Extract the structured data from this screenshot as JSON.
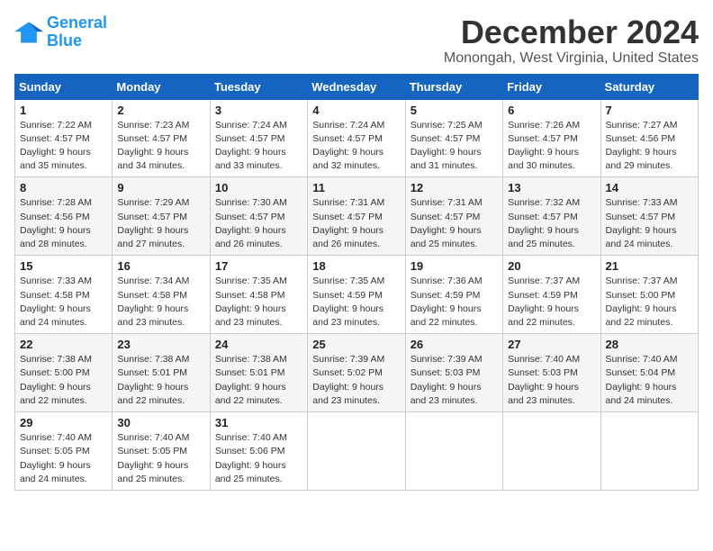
{
  "logo": {
    "line1": "General",
    "line2": "Blue"
  },
  "title": "December 2024",
  "subtitle": "Monongah, West Virginia, United States",
  "weekdays": [
    "Sunday",
    "Monday",
    "Tuesday",
    "Wednesday",
    "Thursday",
    "Friday",
    "Saturday"
  ],
  "weeks": [
    [
      {
        "day": "1",
        "info": "Sunrise: 7:22 AM\nSunset: 4:57 PM\nDaylight: 9 hours\nand 35 minutes."
      },
      {
        "day": "2",
        "info": "Sunrise: 7:23 AM\nSunset: 4:57 PM\nDaylight: 9 hours\nand 34 minutes."
      },
      {
        "day": "3",
        "info": "Sunrise: 7:24 AM\nSunset: 4:57 PM\nDaylight: 9 hours\nand 33 minutes."
      },
      {
        "day": "4",
        "info": "Sunrise: 7:24 AM\nSunset: 4:57 PM\nDaylight: 9 hours\nand 32 minutes."
      },
      {
        "day": "5",
        "info": "Sunrise: 7:25 AM\nSunset: 4:57 PM\nDaylight: 9 hours\nand 31 minutes."
      },
      {
        "day": "6",
        "info": "Sunrise: 7:26 AM\nSunset: 4:57 PM\nDaylight: 9 hours\nand 30 minutes."
      },
      {
        "day": "7",
        "info": "Sunrise: 7:27 AM\nSunset: 4:56 PM\nDaylight: 9 hours\nand 29 minutes."
      }
    ],
    [
      {
        "day": "8",
        "info": "Sunrise: 7:28 AM\nSunset: 4:56 PM\nDaylight: 9 hours\nand 28 minutes."
      },
      {
        "day": "9",
        "info": "Sunrise: 7:29 AM\nSunset: 4:57 PM\nDaylight: 9 hours\nand 27 minutes."
      },
      {
        "day": "10",
        "info": "Sunrise: 7:30 AM\nSunset: 4:57 PM\nDaylight: 9 hours\nand 26 minutes."
      },
      {
        "day": "11",
        "info": "Sunrise: 7:31 AM\nSunset: 4:57 PM\nDaylight: 9 hours\nand 26 minutes."
      },
      {
        "day": "12",
        "info": "Sunrise: 7:31 AM\nSunset: 4:57 PM\nDaylight: 9 hours\nand 25 minutes."
      },
      {
        "day": "13",
        "info": "Sunrise: 7:32 AM\nSunset: 4:57 PM\nDaylight: 9 hours\nand 25 minutes."
      },
      {
        "day": "14",
        "info": "Sunrise: 7:33 AM\nSunset: 4:57 PM\nDaylight: 9 hours\nand 24 minutes."
      }
    ],
    [
      {
        "day": "15",
        "info": "Sunrise: 7:33 AM\nSunset: 4:58 PM\nDaylight: 9 hours\nand 24 minutes."
      },
      {
        "day": "16",
        "info": "Sunrise: 7:34 AM\nSunset: 4:58 PM\nDaylight: 9 hours\nand 23 minutes."
      },
      {
        "day": "17",
        "info": "Sunrise: 7:35 AM\nSunset: 4:58 PM\nDaylight: 9 hours\nand 23 minutes."
      },
      {
        "day": "18",
        "info": "Sunrise: 7:35 AM\nSunset: 4:59 PM\nDaylight: 9 hours\nand 23 minutes."
      },
      {
        "day": "19",
        "info": "Sunrise: 7:36 AM\nSunset: 4:59 PM\nDaylight: 9 hours\nand 22 minutes."
      },
      {
        "day": "20",
        "info": "Sunrise: 7:37 AM\nSunset: 4:59 PM\nDaylight: 9 hours\nand 22 minutes."
      },
      {
        "day": "21",
        "info": "Sunrise: 7:37 AM\nSunset: 5:00 PM\nDaylight: 9 hours\nand 22 minutes."
      }
    ],
    [
      {
        "day": "22",
        "info": "Sunrise: 7:38 AM\nSunset: 5:00 PM\nDaylight: 9 hours\nand 22 minutes."
      },
      {
        "day": "23",
        "info": "Sunrise: 7:38 AM\nSunset: 5:01 PM\nDaylight: 9 hours\nand 22 minutes."
      },
      {
        "day": "24",
        "info": "Sunrise: 7:38 AM\nSunset: 5:01 PM\nDaylight: 9 hours\nand 22 minutes."
      },
      {
        "day": "25",
        "info": "Sunrise: 7:39 AM\nSunset: 5:02 PM\nDaylight: 9 hours\nand 23 minutes."
      },
      {
        "day": "26",
        "info": "Sunrise: 7:39 AM\nSunset: 5:03 PM\nDaylight: 9 hours\nand 23 minutes."
      },
      {
        "day": "27",
        "info": "Sunrise: 7:40 AM\nSunset: 5:03 PM\nDaylight: 9 hours\nand 23 minutes."
      },
      {
        "day": "28",
        "info": "Sunrise: 7:40 AM\nSunset: 5:04 PM\nDaylight: 9 hours\nand 24 minutes."
      }
    ],
    [
      {
        "day": "29",
        "info": "Sunrise: 7:40 AM\nSunset: 5:05 PM\nDaylight: 9 hours\nand 24 minutes."
      },
      {
        "day": "30",
        "info": "Sunrise: 7:40 AM\nSunset: 5:05 PM\nDaylight: 9 hours\nand 25 minutes."
      },
      {
        "day": "31",
        "info": "Sunrise: 7:40 AM\nSunset: 5:06 PM\nDaylight: 9 hours\nand 25 minutes."
      },
      null,
      null,
      null,
      null
    ]
  ]
}
